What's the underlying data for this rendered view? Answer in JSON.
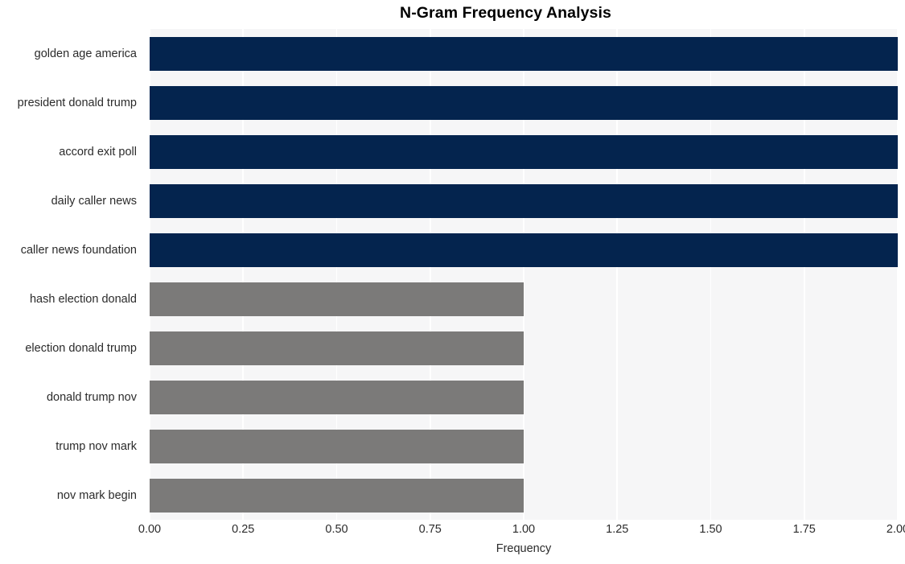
{
  "chart_data": {
    "type": "bar",
    "orientation": "horizontal",
    "title": "N-Gram Frequency Analysis",
    "xlabel": "Frequency",
    "ylabel": "",
    "categories": [
      "golden age america",
      "president donald trump",
      "accord exit poll",
      "daily caller news",
      "caller news foundation",
      "hash election donald",
      "election donald trump",
      "donald trump nov",
      "trump nov mark",
      "nov mark begin"
    ],
    "values": [
      2,
      2,
      2,
      2,
      2,
      1,
      1,
      1,
      1,
      1
    ],
    "bar_colors": [
      "#04244e",
      "#04244e",
      "#04244e",
      "#04244e",
      "#04244e",
      "#7b7a79",
      "#7b7a79",
      "#7b7a79",
      "#7b7a79",
      "#7b7a79"
    ],
    "xlim": [
      0,
      2
    ],
    "xticks": [
      0,
      0.25,
      0.5,
      0.75,
      1,
      1.25,
      1.5,
      1.75,
      2
    ],
    "xticklabels": [
      "0.00",
      "0.25",
      "0.50",
      "0.75",
      "1.00",
      "1.25",
      "1.50",
      "1.75",
      "2.00"
    ],
    "grid": true,
    "grid_axis": "x",
    "grid_color": "#ffffff",
    "legend": null,
    "plot_background": "#f6f6f7",
    "figure_background": "#ffffff",
    "title_color": "#000000",
    "tick_color": "#2b2b2b"
  }
}
